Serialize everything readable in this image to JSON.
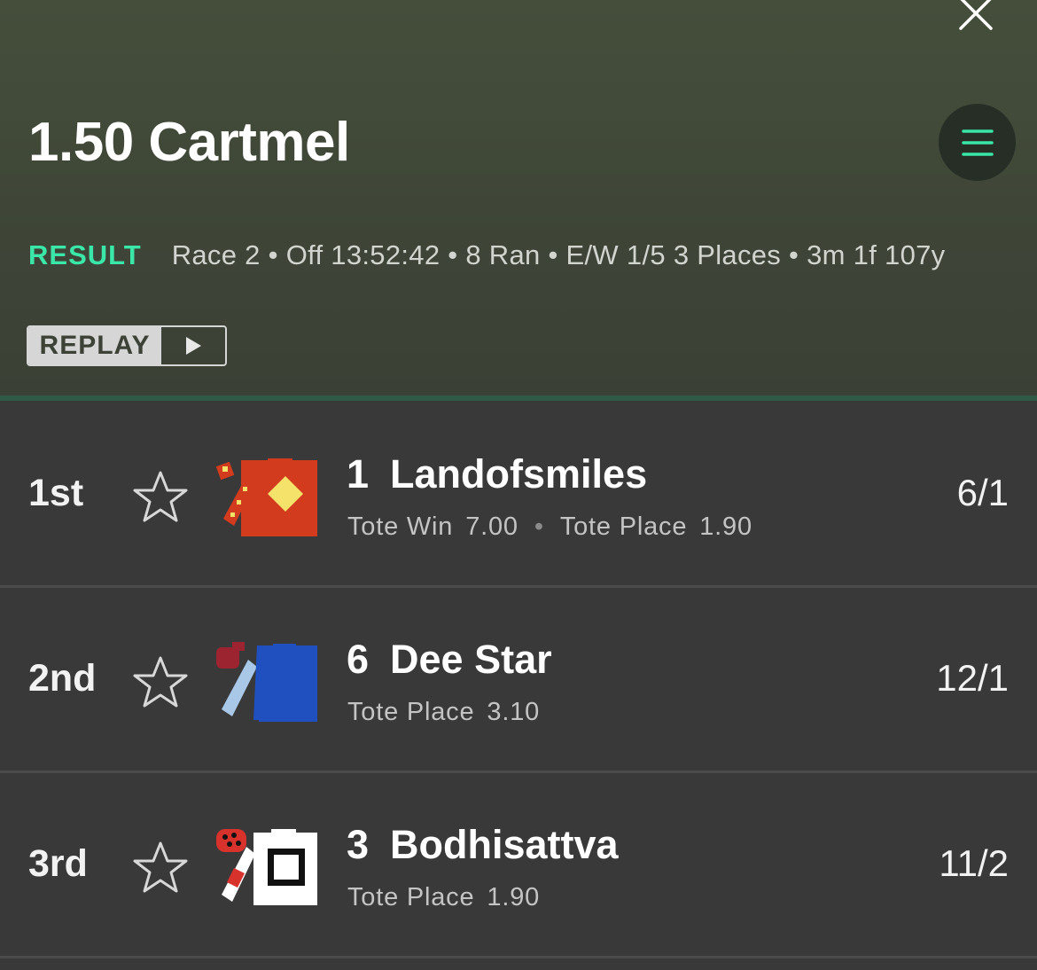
{
  "header": {
    "title": "1.50 Cartmel",
    "result_label": "RESULT",
    "race_details": "Race 2 • Off 13:52:42 • 8 Ran • E/W 1/5 3 Places • 3m 1f 107y",
    "replay_label": "REPLAY",
    "accent_color": "#3ae6a8"
  },
  "results": [
    {
      "position": "1st",
      "number": "1",
      "name": "Landofsmiles",
      "tote_win_label": "Tote Win",
      "tote_win": "7.00",
      "tote_place_label": "Tote Place",
      "tote_place": "1.90",
      "odds": "6/1",
      "silk_colors": [
        "#d23b1e",
        "#f5e26a"
      ]
    },
    {
      "position": "2nd",
      "number": "6",
      "name": "Dee Star",
      "tote_place_label": "Tote Place",
      "tote_place": "3.10",
      "odds": "12/1",
      "silk_colors": [
        "#2050c0",
        "#a9c8e8",
        "#9b2430"
      ]
    },
    {
      "position": "3rd",
      "number": "3",
      "name": "Bodhisattva",
      "tote_place_label": "Tote Place",
      "tote_place": "1.90",
      "odds": "11/2",
      "silk_colors": [
        "#ffffff",
        "#111111",
        "#d8322c"
      ]
    }
  ]
}
